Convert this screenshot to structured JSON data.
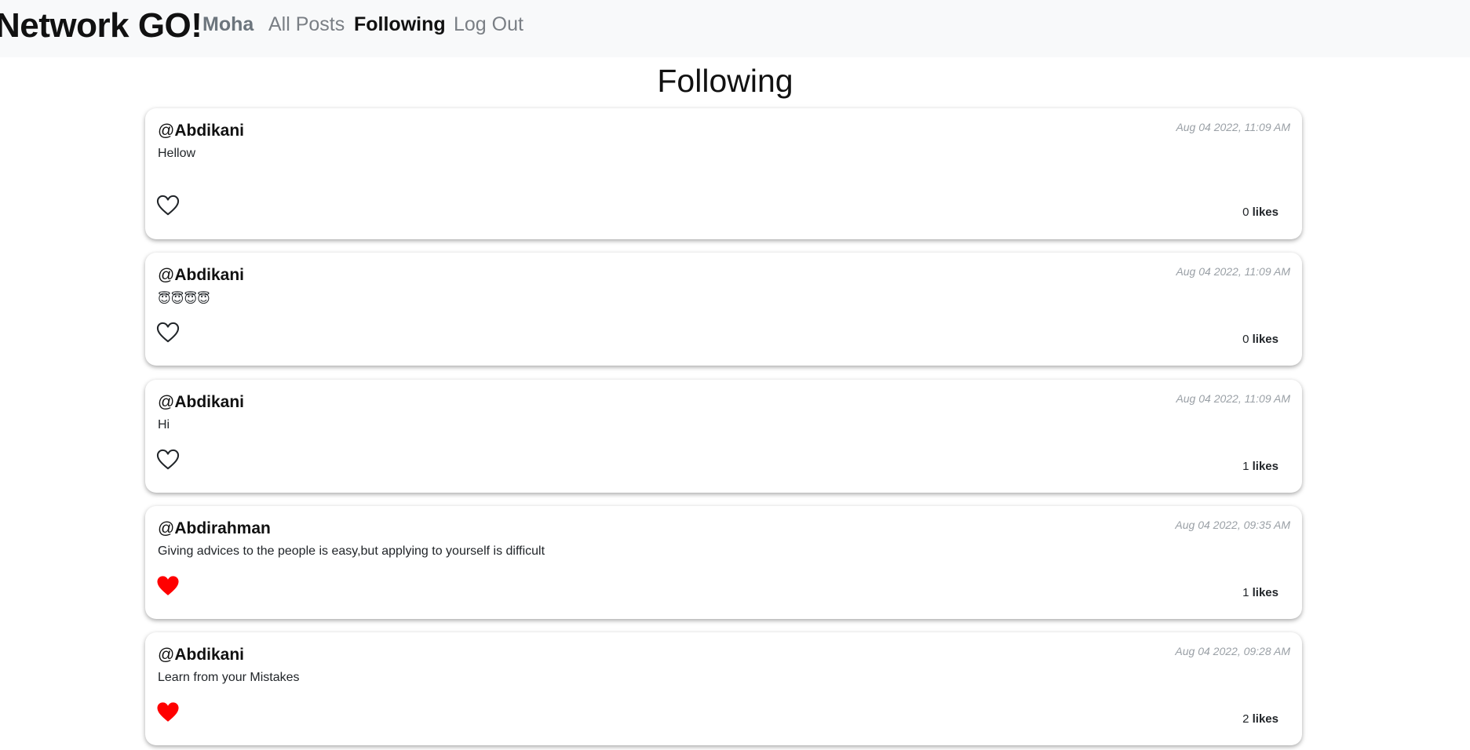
{
  "navbar": {
    "brand": "Network GO!",
    "user": "Moha",
    "all_posts": "All Posts",
    "following": "Following",
    "logout": "Log Out"
  },
  "page": {
    "title": "Following"
  },
  "colors": {
    "liked_heart": "#ff0000",
    "unliked_heart": "#212529"
  },
  "posts": [
    {
      "at": "@",
      "username": "Abdikani",
      "date": "Aug 04 2022, 11:09 AM",
      "body": "Hellow",
      "likes": "0",
      "likes_label": "likes",
      "liked": false,
      "icon": "heart-outline-icon"
    },
    {
      "at": "@",
      "username": "Abdikani",
      "date": "Aug 04 2022, 11:09 AM",
      "body": "😇😇😇😇",
      "likes": "0",
      "likes_label": "likes",
      "liked": false,
      "icon": "heart-outline-icon"
    },
    {
      "at": "@",
      "username": "Abdikani",
      "date": "Aug 04 2022, 11:09 AM",
      "body": "Hi",
      "likes": "1",
      "likes_label": "likes",
      "liked": false,
      "icon": "heart-outline-icon"
    },
    {
      "at": "@",
      "username": "Abdirahman",
      "date": "Aug 04 2022, 09:35 AM",
      "body": "Giving advices to the people is easy,but applying to yourself is difficult",
      "likes": "1",
      "likes_label": "likes",
      "liked": true,
      "icon": "heart-filled-icon"
    },
    {
      "at": "@",
      "username": "Abdikani",
      "date": "Aug 04 2022, 09:28 AM",
      "body": "Learn from your Mistakes",
      "likes": "2",
      "likes_label": "likes",
      "liked": true,
      "icon": "heart-filled-icon"
    }
  ]
}
